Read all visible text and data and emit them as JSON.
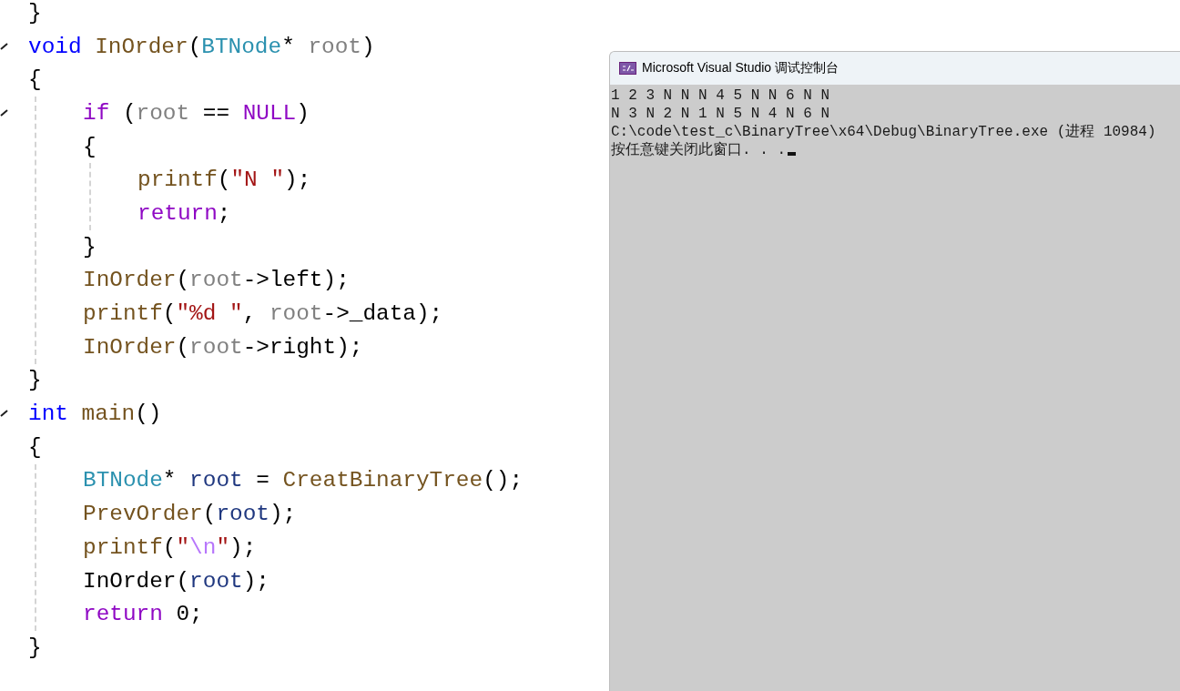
{
  "editor": {
    "lines": [
      {
        "kind": "line",
        "collapsible": false,
        "tokens": [
          {
            "kind": "plain",
            "text": "}"
          }
        ]
      },
      {
        "kind": "line",
        "collapsible": true,
        "tokens": [
          {
            "kind": "kw",
            "text": "void "
          },
          {
            "kind": "fn",
            "text": "InOrder"
          },
          {
            "kind": "plain",
            "text": "("
          },
          {
            "kind": "type",
            "text": "BTNode"
          },
          {
            "kind": "plain",
            "text": "* "
          },
          {
            "kind": "param",
            "text": "root"
          },
          {
            "kind": "plain",
            "text": ")"
          }
        ]
      },
      {
        "kind": "line",
        "collapsible": false,
        "tokens": [
          {
            "kind": "plain",
            "text": "{"
          }
        ]
      },
      {
        "kind": "block",
        "children": [
          {
            "kind": "line",
            "collapsible": true,
            "tokens": [
              {
                "kind": "ctl",
                "text": "if"
              },
              {
                "kind": "plain",
                "text": " ("
              },
              {
                "kind": "param",
                "text": "root"
              },
              {
                "kind": "plain",
                "text": " == "
              },
              {
                "kind": "ctl",
                "text": "NULL"
              },
              {
                "kind": "plain",
                "text": ")"
              }
            ]
          },
          {
            "kind": "line",
            "collapsible": false,
            "tokens": [
              {
                "kind": "plain",
                "text": "{"
              }
            ]
          },
          {
            "kind": "block",
            "children": [
              {
                "kind": "line",
                "collapsible": false,
                "tokens": [
                  {
                    "kind": "fn",
                    "text": "printf"
                  },
                  {
                    "kind": "plain",
                    "text": "("
                  },
                  {
                    "kind": "str",
                    "text": "\"N \""
                  },
                  {
                    "kind": "plain",
                    "text": ");"
                  }
                ]
              },
              {
                "kind": "line",
                "collapsible": false,
                "tokens": [
                  {
                    "kind": "ctl",
                    "text": "return"
                  },
                  {
                    "kind": "plain",
                    "text": ";"
                  }
                ]
              }
            ]
          },
          {
            "kind": "line",
            "collapsible": false,
            "tokens": [
              {
                "kind": "plain",
                "text": "}"
              }
            ]
          },
          {
            "kind": "line",
            "collapsible": false,
            "tokens": [
              {
                "kind": "fn",
                "text": "InOrder"
              },
              {
                "kind": "plain",
                "text": "("
              },
              {
                "kind": "param",
                "text": "root"
              },
              {
                "kind": "plain",
                "text": "->left);"
              }
            ]
          },
          {
            "kind": "line",
            "collapsible": false,
            "tokens": [
              {
                "kind": "fn",
                "text": "printf"
              },
              {
                "kind": "plain",
                "text": "("
              },
              {
                "kind": "str",
                "text": "\"%d \""
              },
              {
                "kind": "plain",
                "text": ", "
              },
              {
                "kind": "param",
                "text": "root"
              },
              {
                "kind": "plain",
                "text": "->_data);"
              }
            ]
          },
          {
            "kind": "line",
            "collapsible": false,
            "tokens": [
              {
                "kind": "fn",
                "text": "InOrder"
              },
              {
                "kind": "plain",
                "text": "("
              },
              {
                "kind": "param",
                "text": "root"
              },
              {
                "kind": "plain",
                "text": "->right);"
              }
            ]
          }
        ]
      },
      {
        "kind": "line",
        "collapsible": false,
        "tokens": [
          {
            "kind": "plain",
            "text": "}"
          }
        ]
      },
      {
        "kind": "line",
        "collapsible": true,
        "tokens": [
          {
            "kind": "kw",
            "text": "int "
          },
          {
            "kind": "fn",
            "text": "main"
          },
          {
            "kind": "plain",
            "text": "()"
          }
        ]
      },
      {
        "kind": "line",
        "collapsible": false,
        "tokens": [
          {
            "kind": "plain",
            "text": "{"
          }
        ]
      },
      {
        "kind": "block",
        "children": [
          {
            "kind": "line",
            "collapsible": false,
            "tokens": [
              {
                "kind": "type",
                "text": "BTNode"
              },
              {
                "kind": "plain",
                "text": "* "
              },
              {
                "kind": "local",
                "text": "root"
              },
              {
                "kind": "plain",
                "text": " = "
              },
              {
                "kind": "fn",
                "text": "CreatBinaryTree"
              },
              {
                "kind": "plain",
                "text": "();"
              }
            ]
          },
          {
            "kind": "line",
            "collapsible": false,
            "tokens": [
              {
                "kind": "fn",
                "text": "PrevOrder"
              },
              {
                "kind": "plain",
                "text": "("
              },
              {
                "kind": "local",
                "text": "root"
              },
              {
                "kind": "plain",
                "text": ");"
              }
            ]
          },
          {
            "kind": "line",
            "collapsible": false,
            "tokens": [
              {
                "kind": "fn",
                "text": "printf"
              },
              {
                "kind": "plain",
                "text": "("
              },
              {
                "kind": "str",
                "text": "\""
              },
              {
                "kind": "esc",
                "text": "\\n"
              },
              {
                "kind": "str",
                "text": "\""
              },
              {
                "kind": "plain",
                "text": ");"
              }
            ]
          },
          {
            "kind": "line",
            "collapsible": false,
            "tokens": [
              {
                "kind": "plain",
                "text": "InOrder("
              },
              {
                "kind": "local",
                "text": "root"
              },
              {
                "kind": "plain",
                "text": ");"
              }
            ]
          },
          {
            "kind": "line",
            "collapsible": false,
            "tokens": [
              {
                "kind": "ctl",
                "text": "return"
              },
              {
                "kind": "plain",
                "text": " 0;"
              }
            ]
          }
        ]
      },
      {
        "kind": "line",
        "collapsible": false,
        "tokens": [
          {
            "kind": "plain",
            "text": "}"
          }
        ]
      }
    ]
  },
  "console": {
    "title": "Microsoft Visual Studio 调试控制台",
    "lines": [
      "1 2 3 N N N 4 5 N N 6 N N",
      "N 3 N 2 N 1 N 5 N 4 N 6 N",
      "C:\\code\\test_c\\BinaryTree\\x64\\Debug\\BinaryTree.exe (进程 10984)",
      "按任意键关闭此窗口. . ."
    ],
    "cursor": true
  }
}
